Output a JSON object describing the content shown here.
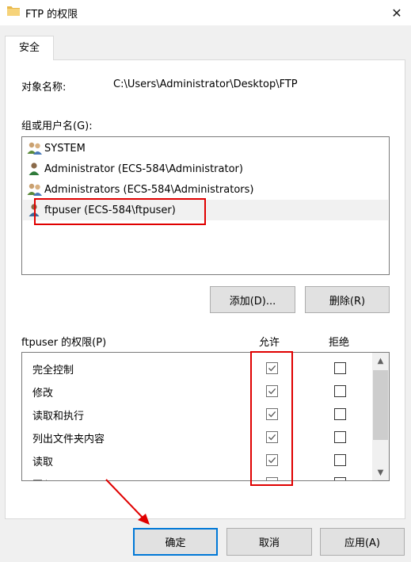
{
  "window": {
    "title": "FTP 的权限",
    "close_icon": "close-icon"
  },
  "tabs": [
    {
      "label": "安全"
    }
  ],
  "object": {
    "label": "对象名称:",
    "value": "C:\\Users\\Administrator\\Desktop\\FTP"
  },
  "groups": {
    "label": "组或用户名(G):",
    "items": [
      {
        "name": "SYSTEM",
        "icon": "group-users-icon"
      },
      {
        "name": "Administrator (ECS-584\\Administrator)",
        "icon": "user-icon"
      },
      {
        "name": "Administrators (ECS-584\\Administrators)",
        "icon": "group-users-icon"
      },
      {
        "name": "ftpuser (ECS-584\\ftpuser)",
        "icon": "user-icon",
        "selected": true
      }
    ]
  },
  "buttons": {
    "add": "添加(D)...",
    "remove": "删除(R)",
    "ok": "确定",
    "cancel": "取消",
    "apply": "应用(A)"
  },
  "permissions": {
    "label": "ftpuser 的权限(P)",
    "allow_header": "允许",
    "deny_header": "拒绝",
    "rows": [
      {
        "name": "完全控制",
        "allow": true,
        "deny": false
      },
      {
        "name": "修改",
        "allow": true,
        "deny": false
      },
      {
        "name": "读取和执行",
        "allow": true,
        "deny": false
      },
      {
        "name": "列出文件夹内容",
        "allow": true,
        "deny": false
      },
      {
        "name": "读取",
        "allow": true,
        "deny": false
      },
      {
        "name": "写入",
        "allow": true,
        "deny": false
      }
    ]
  },
  "colors": {
    "highlight_red": "#e00000",
    "accent_blue": "#0078d7"
  }
}
